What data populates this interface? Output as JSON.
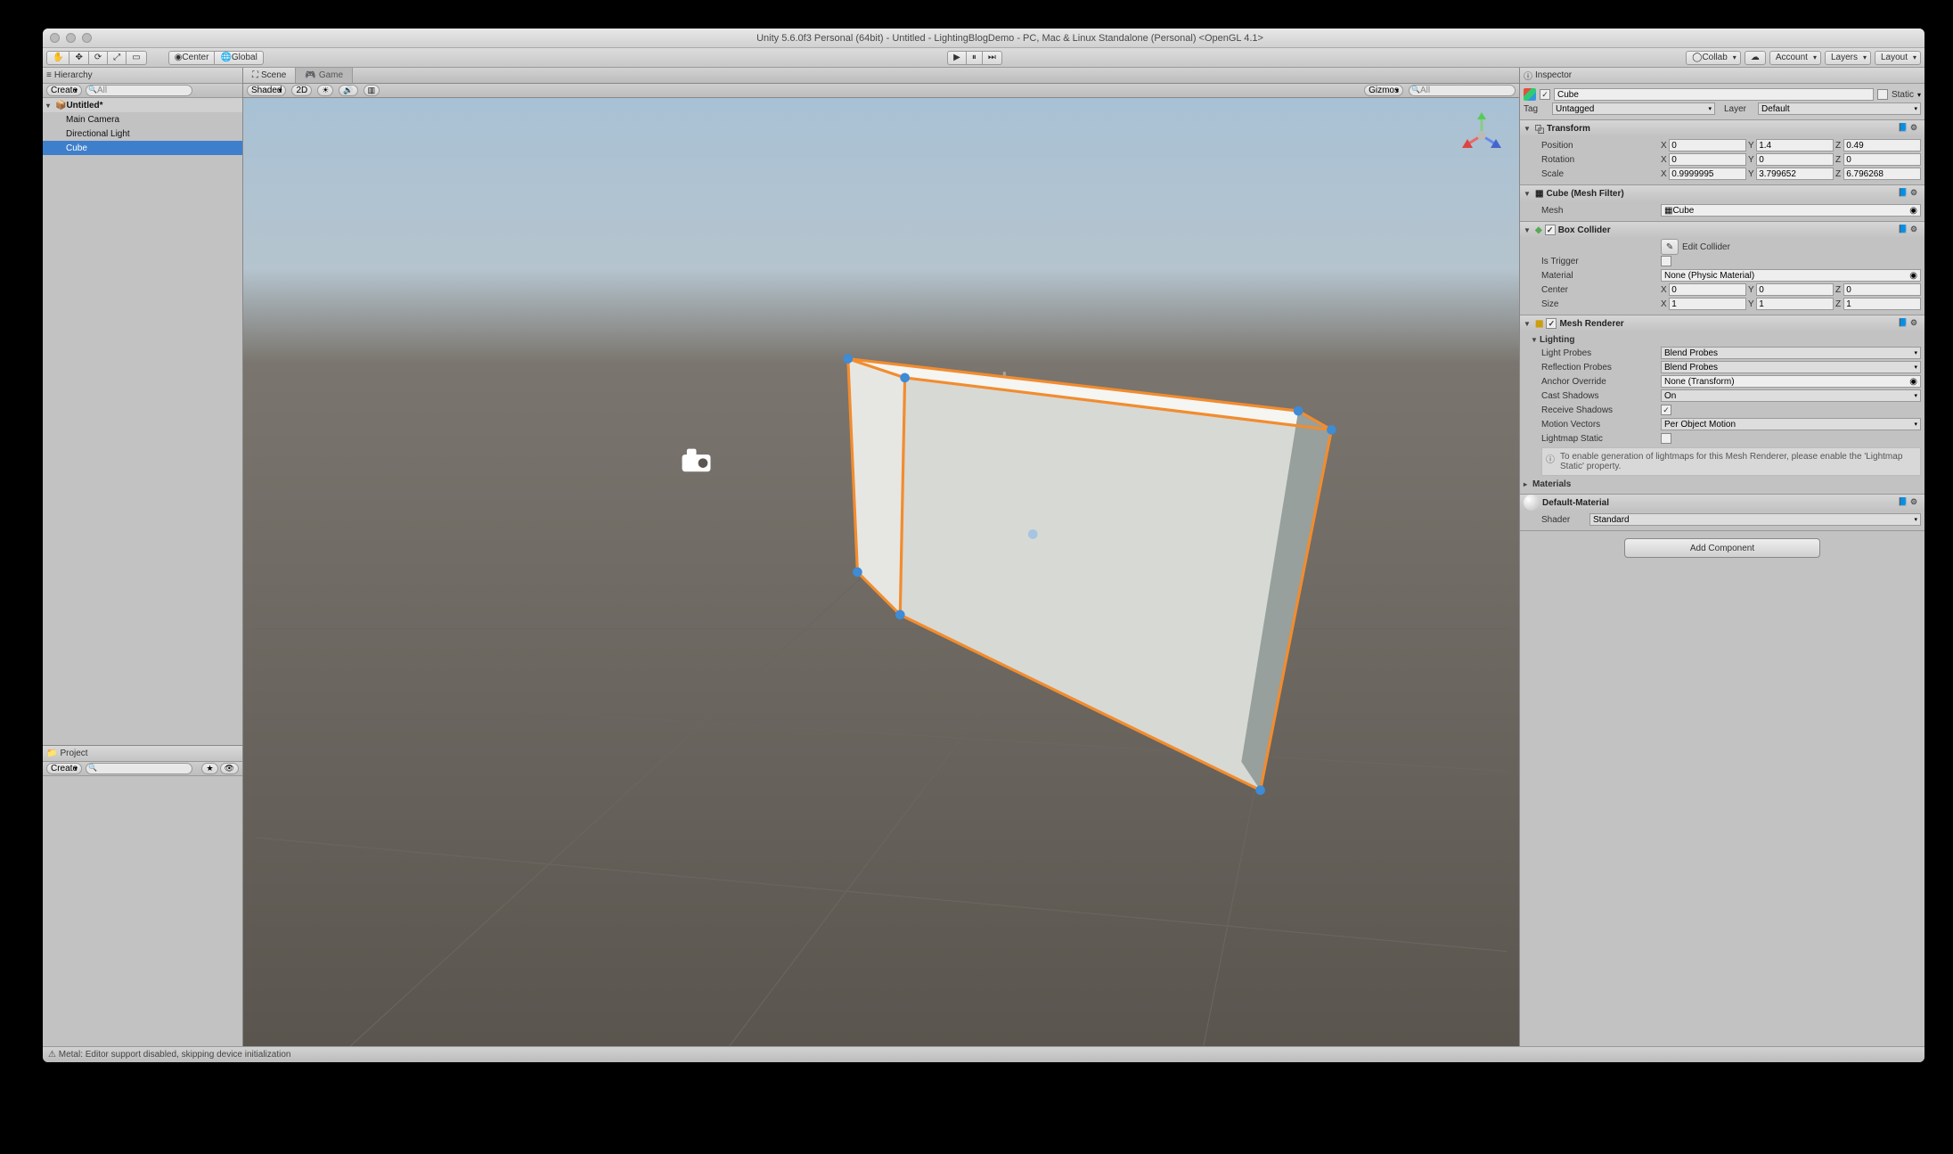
{
  "title": "Unity 5.6.0f3 Personal (64bit) - Untitled - LightingBlogDemo - PC, Mac & Linux Standalone (Personal) <OpenGL 4.1>",
  "toolbar": {
    "center": "Center",
    "global": "Global",
    "collab": "Collab",
    "account": "Account",
    "layers": "Layers",
    "layout": "Layout"
  },
  "hierarchy": {
    "tab": "Hierarchy",
    "create": "Create",
    "scene": "Untitled*",
    "items": [
      "Main Camera",
      "Directional Light",
      "Cube"
    ],
    "selected": 2
  },
  "project": {
    "tab": "Project",
    "create": "Create"
  },
  "scene": {
    "tabScene": "Scene",
    "tabGame": "Game",
    "shaded": "Shaded",
    "d2": "2D",
    "gizmos": "Gizmos",
    "qall": "All"
  },
  "inspector": {
    "tab": "Inspector",
    "name": "Cube",
    "static": "Static",
    "tag": "Tag",
    "tagv": "Untagged",
    "layer": "Layer",
    "layerv": "Default",
    "transform": {
      "title": "Transform",
      "position": "Position",
      "rotation": "Rotation",
      "scale": "Scale",
      "pos": {
        "x": "0",
        "y": "1.4",
        "z": "0.49"
      },
      "rot": {
        "x": "0",
        "y": "0",
        "z": "0"
      },
      "scl": {
        "x": "0.9999995",
        "y": "3.799652",
        "z": "6.796268"
      }
    },
    "meshfilter": {
      "title": "Cube (Mesh Filter)",
      "mesh": "Mesh",
      "meshv": "Cube"
    },
    "boxcollider": {
      "title": "Box Collider",
      "edit": "Edit Collider",
      "istrigger": "Is Trigger",
      "material": "Material",
      "materialv": "None (Physic Material)",
      "center": "Center",
      "size": "Size",
      "c": {
        "x": "0",
        "y": "0",
        "z": "0"
      },
      "s": {
        "x": "1",
        "y": "1",
        "z": "1"
      }
    },
    "meshrenderer": {
      "title": "Mesh Renderer",
      "lighting": "Lighting",
      "lightprobes": "Light Probes",
      "lightprobesv": "Blend Probes",
      "reflprobes": "Reflection Probes",
      "reflprobesv": "Blend Probes",
      "anchor": "Anchor Override",
      "anchorv": "None (Transform)",
      "castshadows": "Cast Shadows",
      "castshadowsv": "On",
      "recvshadows": "Receive Shadows",
      "motion": "Motion Vectors",
      "motionv": "Per Object Motion",
      "lmstatic": "Lightmap Static",
      "info": "To enable generation of lightmaps for this Mesh Renderer, please enable the 'Lightmap Static' property.",
      "materials": "Materials"
    },
    "material": {
      "name": "Default-Material",
      "shader": "Shader",
      "shaderv": "Standard"
    },
    "addcomp": "Add Component"
  },
  "status": "Metal: Editor support disabled, skipping device initialization"
}
